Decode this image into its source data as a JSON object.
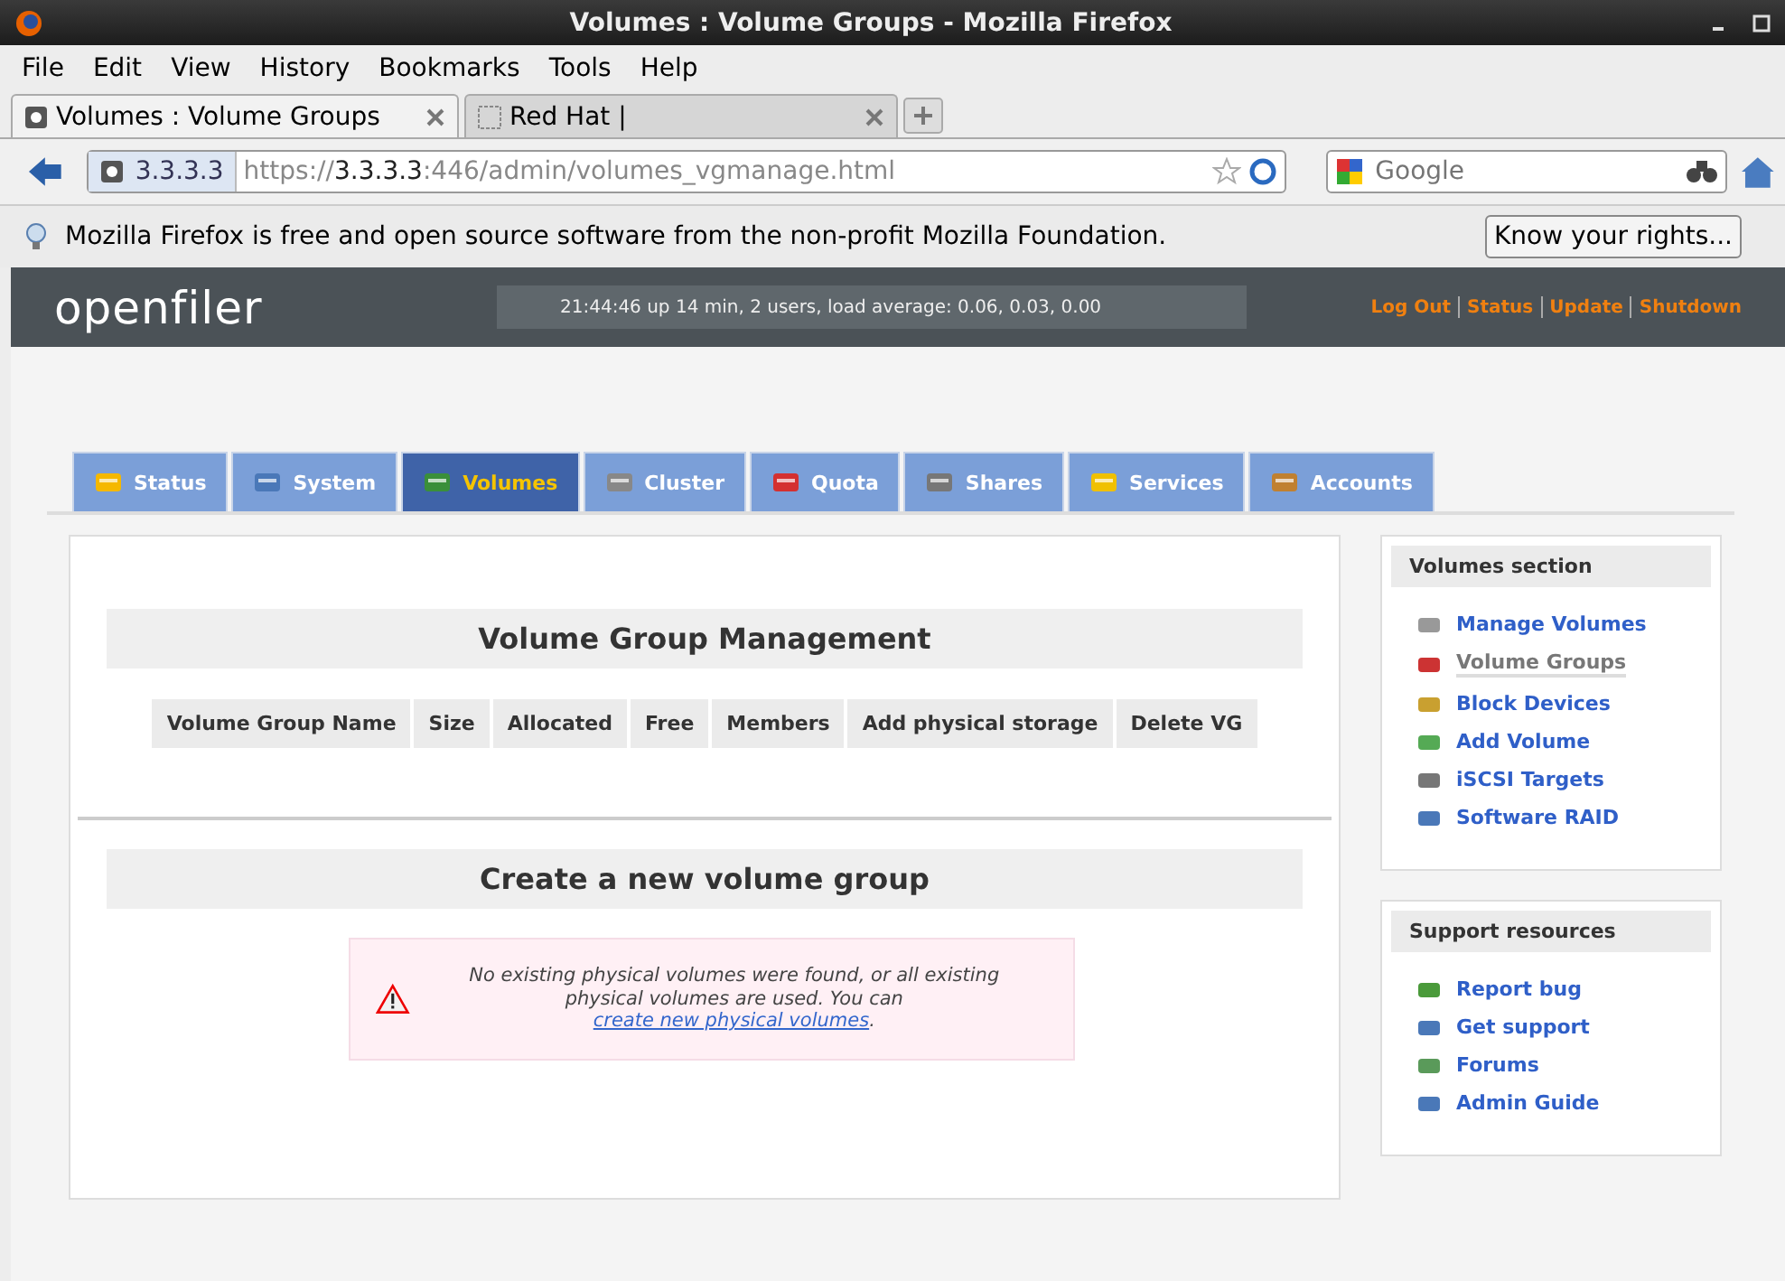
{
  "window": {
    "title": "Volumes : Volume Groups - Mozilla Firefox"
  },
  "menu": [
    "File",
    "Edit",
    "View",
    "History",
    "Bookmarks",
    "Tools",
    "Help"
  ],
  "browser_tabs": [
    {
      "label": "Volumes : Volume Groups",
      "selected": true
    },
    {
      "label": "Red Hat |",
      "selected": false
    }
  ],
  "address_bar": {
    "site": "3.3.3.3",
    "url_prefix": "https://",
    "url_host": "3.3.3.3",
    "url_rest": ":446/admin/volumes_vgmanage.html"
  },
  "search": {
    "placeholder": "Google"
  },
  "notification": {
    "text": "Mozilla Firefox is free and open source software from the non-profit Mozilla Foundation.",
    "button": "Know your rights..."
  },
  "header": {
    "logo": "openfiler",
    "uptime": "21:44:46 up 14 min, 2 users, load average: 0.06, 0.03, 0.00",
    "links": [
      "Log Out",
      "Status",
      "Update",
      "Shutdown"
    ]
  },
  "nav_tabs": [
    {
      "label": "Status",
      "selected": false
    },
    {
      "label": "System",
      "selected": false
    },
    {
      "label": "Volumes",
      "selected": true
    },
    {
      "label": "Cluster",
      "selected": false
    },
    {
      "label": "Quota",
      "selected": false
    },
    {
      "label": "Shares",
      "selected": false
    },
    {
      "label": "Services",
      "selected": false
    },
    {
      "label": "Accounts",
      "selected": false
    }
  ],
  "main": {
    "title": "Volume Group Management",
    "table": {
      "columns": [
        "Volume Group Name",
        "Size",
        "Allocated",
        "Free",
        "Members",
        "Add physical storage",
        "Delete VG"
      ]
    },
    "create_title": "Create a new volume group",
    "warning": {
      "before": "No existing physical volumes were found, or all existing physical volumes are used. You can ",
      "link": "create new physical volumes",
      "after": "."
    }
  },
  "sidebar": [
    {
      "title": "Volumes section",
      "items": [
        {
          "label": "Manage Volumes",
          "selected": false
        },
        {
          "label": "Volume Groups",
          "selected": true
        },
        {
          "label": "Block Devices",
          "selected": false
        },
        {
          "label": "Add Volume",
          "selected": false
        },
        {
          "label": "iSCSI Targets",
          "selected": false
        },
        {
          "label": "Software RAID",
          "selected": false
        }
      ]
    },
    {
      "title": "Support resources",
      "items": [
        {
          "label": "Report bug",
          "selected": false
        },
        {
          "label": "Get support",
          "selected": false
        },
        {
          "label": "Forums",
          "selected": false
        },
        {
          "label": "Admin Guide",
          "selected": false
        }
      ]
    }
  ]
}
